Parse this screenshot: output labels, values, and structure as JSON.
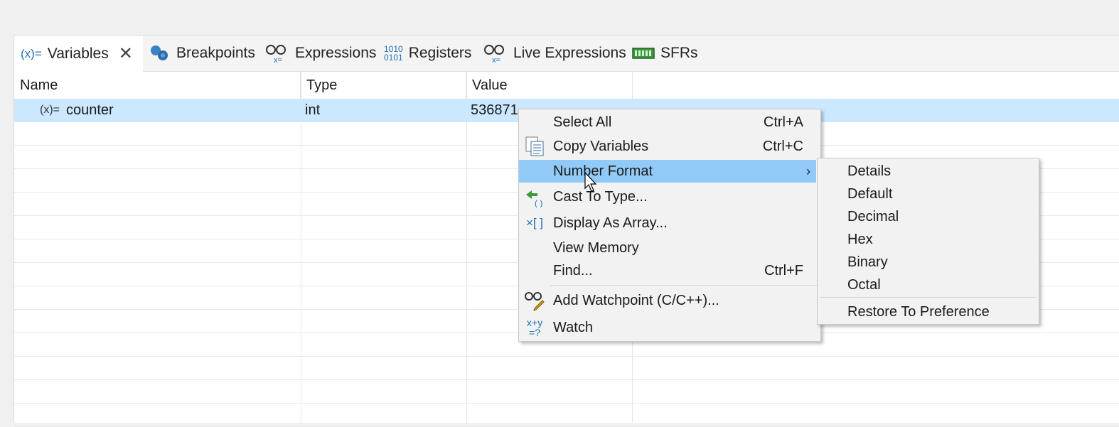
{
  "tabs": [
    {
      "label": "Variables",
      "icon": "variables-icon",
      "active": true
    },
    {
      "label": "Breakpoints",
      "icon": "breakpoints-icon"
    },
    {
      "label": "Expressions",
      "icon": "expressions-icon"
    },
    {
      "label": "Registers",
      "icon": "registers-icon"
    },
    {
      "label": "Live Expressions",
      "icon": "live-expressions-icon"
    },
    {
      "label": "SFRs",
      "icon": "sfrs-icon"
    }
  ],
  "icon_text": {
    "variables": "(x)=",
    "registers_top": "1010",
    "registers_bottom": "0101",
    "row_var": "(x)=",
    "array": "×[ ]",
    "watch_top": "x+y",
    "watch_bottom": "=?"
  },
  "table": {
    "columns": [
      "Name",
      "Type",
      "Value"
    ],
    "rows": [
      {
        "name": "counter",
        "type": "int",
        "value": "536871"
      }
    ]
  },
  "context_menu": {
    "items": [
      {
        "label": "Select All",
        "shortcut": "Ctrl+A"
      },
      {
        "label": "Copy Variables",
        "shortcut": "Ctrl+C"
      },
      {
        "label": "Number Format",
        "shortcut": "",
        "submenu": true
      },
      {
        "label": "Cast To Type...",
        "shortcut": ""
      },
      {
        "label": "Display As Array...",
        "shortcut": ""
      },
      {
        "label": "View Memory",
        "shortcut": ""
      },
      {
        "label": "Find...",
        "shortcut": "Ctrl+F"
      },
      {
        "label": "Add Watchpoint (C/C++)...",
        "shortcut": ""
      },
      {
        "label": "Watch",
        "shortcut": ""
      }
    ],
    "submenu_arrow": "›"
  },
  "number_format_submenu": {
    "items": [
      "Details",
      "Default",
      "Decimal",
      "Hex",
      "Binary",
      "Octal"
    ],
    "restore": "Restore To Preference"
  },
  "colors": {
    "selection": "#cce8ff",
    "menu_highlight": "#91c9f7",
    "icon_blue": "#1e6fb8"
  }
}
